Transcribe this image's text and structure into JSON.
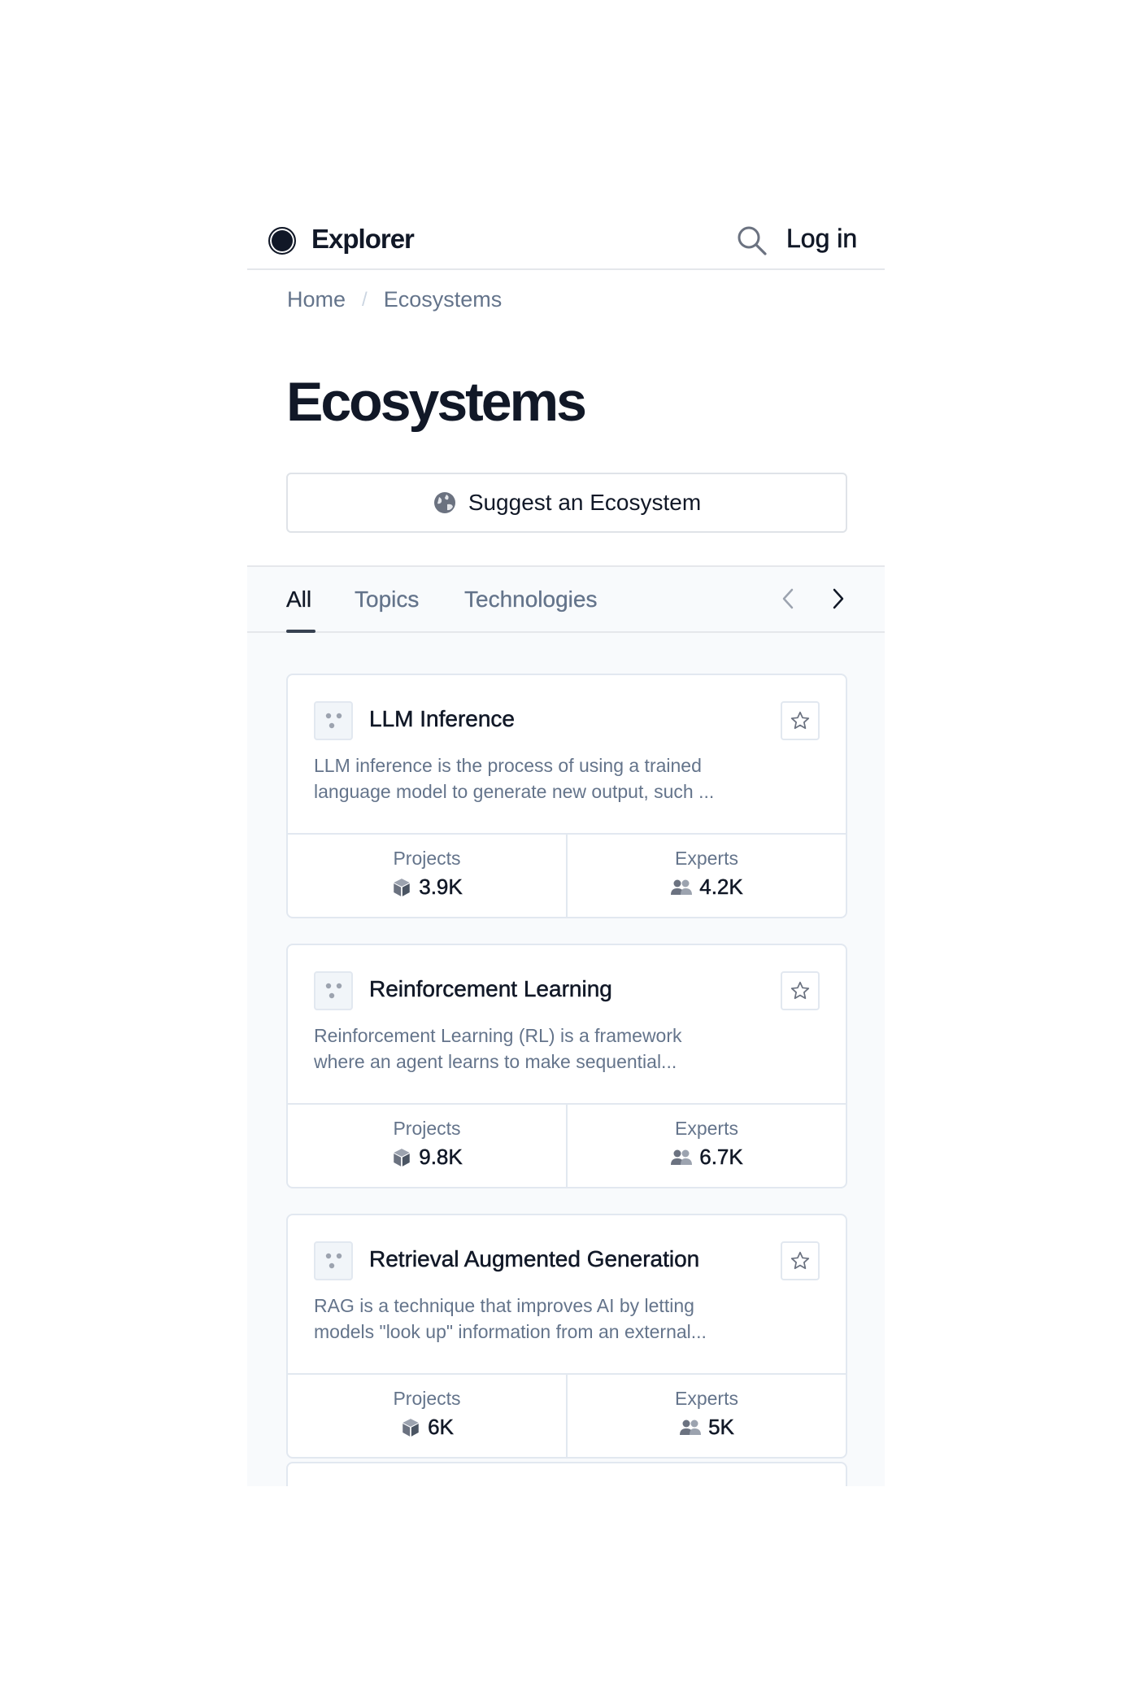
{
  "header": {
    "brand": "Explorer",
    "login_label": "Log in"
  },
  "breadcrumb": {
    "items": [
      "Home",
      "Ecosystems"
    ],
    "separator": "/"
  },
  "page": {
    "title": "Ecosystems",
    "suggest_label": "Suggest an Ecosystem"
  },
  "tabs": {
    "items": [
      "All",
      "Topics",
      "Technologies"
    ],
    "active": "All"
  },
  "cards": [
    {
      "title": "LLM Inference",
      "description": "LLM inference is the process of using a trained\nlanguage model to generate new output, such ...",
      "projects_label": "Projects",
      "projects_value": "3.9K",
      "experts_label": "Experts",
      "experts_value": "4.2K"
    },
    {
      "title": "Reinforcement Learning",
      "description": "Reinforcement Learning (RL) is a framework\nwhere an agent learns to make sequential...",
      "projects_label": "Projects",
      "projects_value": "9.8K",
      "experts_label": "Experts",
      "experts_value": "6.7K"
    },
    {
      "title": "Retrieval Augmented Generation",
      "description": "RAG is a technique that improves AI by letting\nmodels \"look up\" information from an external...",
      "projects_label": "Projects",
      "projects_value": "6K",
      "experts_label": "Experts",
      "experts_value": "5K"
    }
  ],
  "icons": {
    "logo": "circle-logo-icon",
    "search": "search-icon",
    "suggest": "globe-icon",
    "prev": "chevron-left-icon",
    "next": "chevron-right-icon",
    "card": "dots-icon",
    "favorite": "star-icon",
    "projects": "cube-icon",
    "experts": "users-icon"
  },
  "colors": {
    "text": "#111827",
    "muted": "#64748b",
    "border": "#e2e8f0",
    "background_muted": "#f8fafc"
  }
}
